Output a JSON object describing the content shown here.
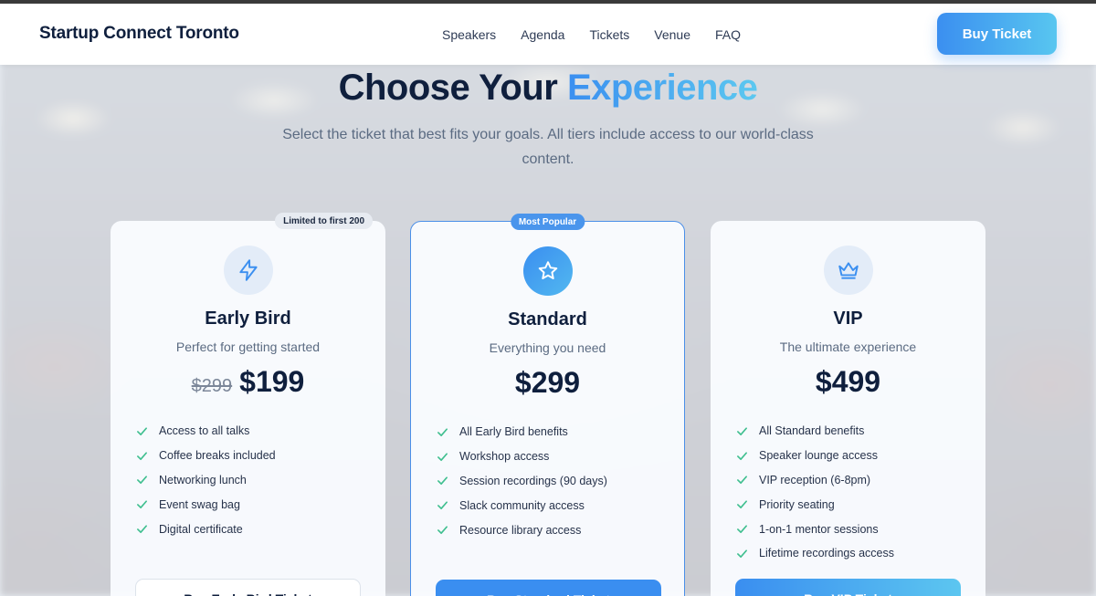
{
  "header": {
    "brand": "Startup Connect Toronto",
    "nav": [
      "Speakers",
      "Agenda",
      "Tickets",
      "Venue",
      "FAQ"
    ],
    "buy_label": "Buy Ticket"
  },
  "hero": {
    "title_main": "Choose Your",
    "title_accent": "Experience",
    "subtitle": "Select the ticket that best fits your goals. All tiers include access to our world-class content."
  },
  "colors": {
    "accent": "#3b8ff0",
    "accent_light": "#5cc8f0",
    "check": "#3fbf8f",
    "heading": "#0f1f3d"
  },
  "tiers": [
    {
      "badge": "Limited to first 200",
      "icon": "lightning-icon",
      "name": "Early Bird",
      "desc": "Perfect for getting started",
      "old_price": "$299",
      "price": "$199",
      "features": [
        "Access to all talks",
        "Coffee breaks included",
        "Networking lunch",
        "Event swag bag",
        "Digital certificate"
      ],
      "cta": "Buy Early Bird Ticket"
    },
    {
      "badge": "Most Popular",
      "icon": "star-icon",
      "name": "Standard",
      "desc": "Everything you need",
      "price": "$299",
      "features": [
        "All Early Bird benefits",
        "Workshop access",
        "Session recordings (90 days)",
        "Slack community access",
        "Resource library access"
      ],
      "cta": "Buy Standard Ticket"
    },
    {
      "icon": "crown-icon",
      "name": "VIP",
      "desc": "The ultimate experience",
      "price": "$499",
      "features": [
        "All Standard benefits",
        "Speaker lounge access",
        "VIP reception (6-8pm)",
        "Priority seating",
        "1-on-1 mentor sessions",
        "Lifetime recordings access"
      ],
      "cta": "Buy VIP Ticket"
    }
  ]
}
